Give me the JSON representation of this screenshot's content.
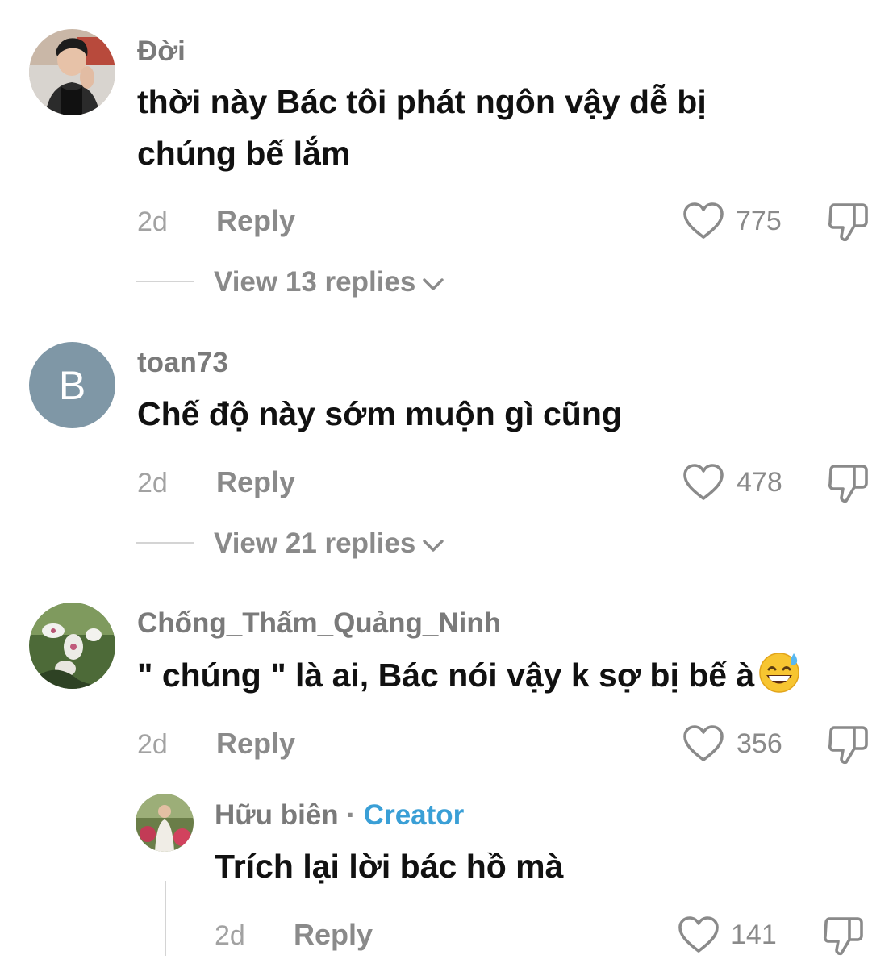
{
  "colors": {
    "text": "#111111",
    "muted": "#8a8a8a",
    "creator": "#3a9fd6",
    "divider": "#d4d4d4"
  },
  "comments": [
    {
      "username": "Đời",
      "text_line1": "thời này Bác tôi phát ngôn vậy dễ bị",
      "text_line2": "chúng bế lắm",
      "time": "2d",
      "reply_label": "Reply",
      "likes": "775",
      "view_replies": "View 13 replies",
      "avatar_icon": "photo-avatar"
    },
    {
      "username": "toan73",
      "avatar_letter": "B",
      "text_line1": "Chế độ này sớm muộn gì cũng",
      "time": "2d",
      "reply_label": "Reply",
      "likes": "478",
      "view_replies": "View 21 replies"
    },
    {
      "username": "Chống_Thấm_Quảng_Ninh",
      "text_line1": "\" chúng \" là ai, Bác nói vậy k sợ bị bế à",
      "emoji": "grinning-sweat-emoji",
      "time": "2d",
      "reply_label": "Reply",
      "likes": "356",
      "avatar_icon": "flower-photo-avatar"
    }
  ],
  "reply": {
    "username": "Hữu biên",
    "separator": "·",
    "badge": "Creator",
    "text": "Trích lại lời bác hồ mà",
    "time": "2d",
    "reply_label": "Reply",
    "likes": "141",
    "avatar_icon": "photo-avatar"
  }
}
